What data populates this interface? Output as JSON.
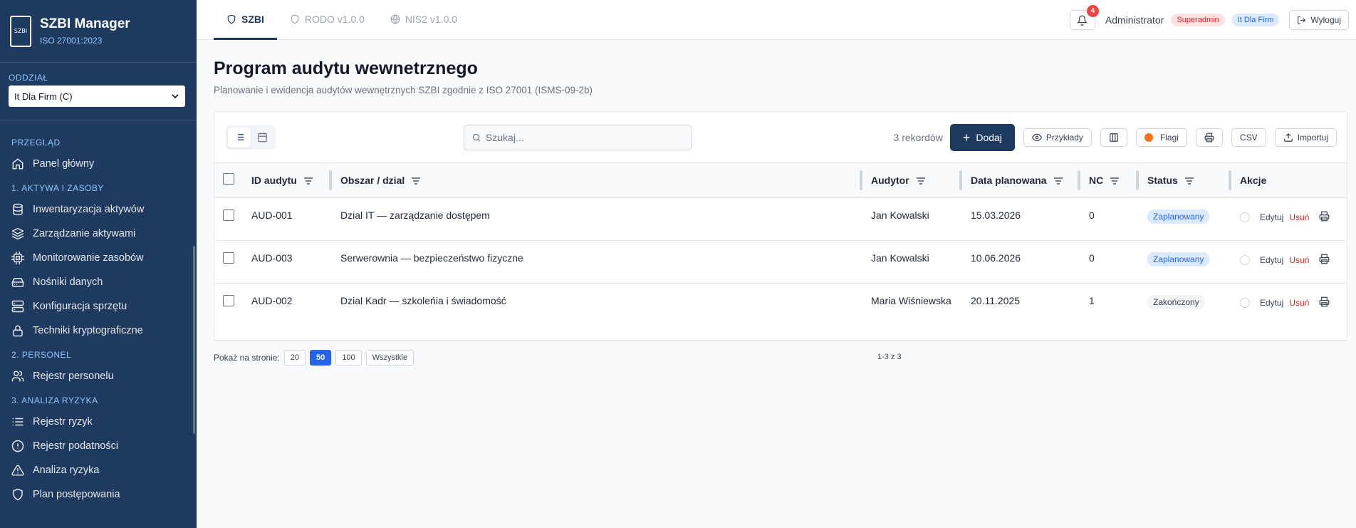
{
  "brand": {
    "title": "SZBI Manager",
    "subtitle": "ISO 27001:2023",
    "logo_text": "SZBI"
  },
  "branch": {
    "label": "ODDZIAŁ",
    "value": "It Dla Firm (C)"
  },
  "sidebar": {
    "sections": [
      {
        "title": "PRZEGLĄD",
        "items": [
          {
            "label": "Panel główny",
            "icon": "home-icon"
          }
        ]
      },
      {
        "title": "1. AKTYWA I ZASOBY",
        "items": [
          {
            "label": "Inwentaryzacja aktywów",
            "icon": "database-icon"
          },
          {
            "label": "Zarządzanie aktywami",
            "icon": "layers-icon"
          },
          {
            "label": "Monitorowanie zasobów",
            "icon": "cpu-icon"
          },
          {
            "label": "Nośniki danych",
            "icon": "hard-drive-icon"
          },
          {
            "label": "Konfiguracja sprzętu",
            "icon": "server-icon"
          },
          {
            "label": "Techniki kryptograficzne",
            "icon": "lock-icon"
          }
        ]
      },
      {
        "title": "2. PERSONEL",
        "items": [
          {
            "label": "Rejestr personelu",
            "icon": "users-icon"
          }
        ]
      },
      {
        "title": "3. ANALIZA RYZYKA",
        "items": [
          {
            "label": "Rejestr ryzyk",
            "icon": "list-icon"
          },
          {
            "label": "Rejestr podatności",
            "icon": "alert-circle-icon"
          },
          {
            "label": "Analiza ryzyka",
            "icon": "alert-triangle-icon"
          },
          {
            "label": "Plan postępowania",
            "icon": "shield-icon"
          }
        ]
      }
    ]
  },
  "tabs": [
    {
      "label": "SZBI",
      "active": true
    },
    {
      "label": "RODO v1.0.0",
      "active": false
    },
    {
      "label": "NIS2 v1.0.0",
      "active": false
    }
  ],
  "header": {
    "notifications": "4",
    "user": "Administrator",
    "role": "Superadmin",
    "org": "It Dla Firm",
    "logout": "Wyloguj"
  },
  "page": {
    "title": "Program audytu wewnetrznego",
    "subtitle": "Planowanie i ewidencja audytów wewnętrznych SZBI zgodnie z ISO 27001 (ISMS-09-2b)"
  },
  "toolbar": {
    "search_placeholder": "Szukaj...",
    "records": "3 rekordów",
    "add": "Dodaj",
    "examples": "Przykłady",
    "flags": "Flagi",
    "csv": "CSV",
    "import": "Importuj"
  },
  "table": {
    "columns": [
      "ID audytu",
      "Obszar / dzial",
      "Audytor",
      "Data planowana",
      "NC",
      "Status",
      "Akcje"
    ],
    "rows": [
      {
        "id": "AUD-001",
        "area": "Dzial IT — zarządzanie dostępem",
        "auditor": "Jan Kowalski",
        "date": "15.03.2026",
        "nc": "0",
        "status": "Zaplanowany",
        "status_type": "planned"
      },
      {
        "id": "AUD-003",
        "area": "Serwerownia — bezpieczeństwo fizyczne",
        "auditor": "Jan Kowalski",
        "date": "10.06.2026",
        "nc": "0",
        "status": "Zaplanowany",
        "status_type": "planned"
      },
      {
        "id": "AUD-002",
        "area": "Dzial Kadr — szkoleńia i świadomość",
        "auditor": "Maria Wiśniewska",
        "date": "20.11.2025",
        "nc": "1",
        "status": "Zakończony",
        "status_type": "done"
      }
    ],
    "edit_label": "Edytuj",
    "delete_label": "Usuń"
  },
  "pager": {
    "label": "Pokaż na stronie:",
    "sizes": [
      "20",
      "50",
      "100",
      "Wszystkie"
    ],
    "active": "50",
    "info": "1-3 z 3"
  },
  "colors": {
    "sidebar": "#1e3a5f",
    "primary": "#1e3a5f",
    "accent": "#2563eb",
    "danger": "#dc2626"
  }
}
